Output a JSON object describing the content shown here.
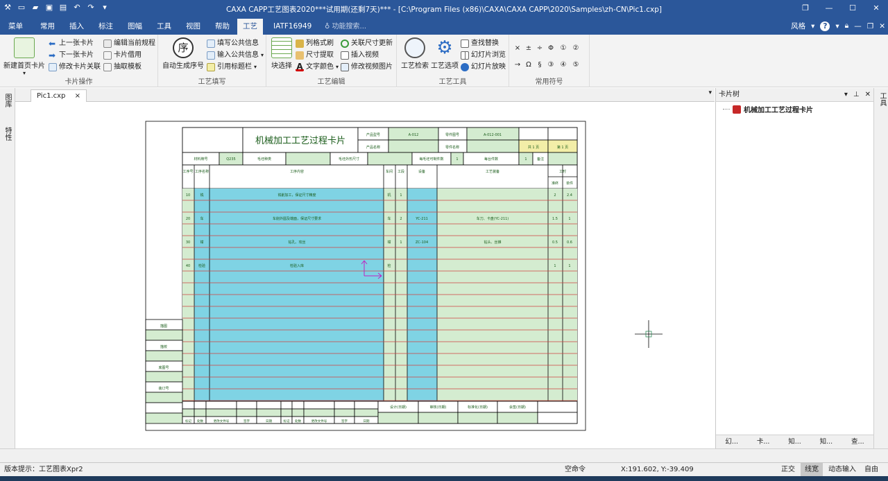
{
  "window": {
    "title": "CAXA CAPP工艺图表2020***试用期(还剩7天)*** - [C:\\Program Files (x86)\\CAXA\\CAXA CAPP\\2020\\Samples\\zh-CN\\Pic1.cxp]",
    "controls": [
      "restore-icon",
      "minimize-icon",
      "maximize-icon",
      "close-icon"
    ]
  },
  "menu": {
    "tabs": [
      "菜单",
      "常用",
      "插入",
      "标注",
      "图幅",
      "工具",
      "视图",
      "帮助",
      "工艺",
      "IATF16949"
    ],
    "active_tab": "工艺",
    "search_placeholder": "功能搜索...",
    "style_label": "风格",
    "help": "?"
  },
  "ribbon": {
    "groups": [
      {
        "label": "卡片操作",
        "big": [
          {
            "label": "新建首页卡片",
            "icon": "new-card-icon"
          }
        ],
        "small": [
          {
            "label": "上一张卡片",
            "icon": "arrow-left-icon"
          },
          {
            "label": "下一张卡片",
            "icon": "arrow-right-icon"
          },
          {
            "label": "修改卡片关联",
            "icon": "link-card-icon"
          },
          {
            "label": "编辑当前规程",
            "icon": "edit-procedure-icon"
          },
          {
            "label": "卡片借用",
            "icon": "borrow-card-icon"
          },
          {
            "label": "抽取模板",
            "icon": "extract-template-icon"
          }
        ]
      },
      {
        "label": "工艺填写",
        "big": [
          {
            "label": "自动生成序号",
            "icon": "sequence-icon",
            "glyph": "序"
          }
        ],
        "small": [
          {
            "label": "填写公共信息",
            "icon": "fill-info-icon"
          },
          {
            "label": "输入公共信息",
            "icon": "input-info-icon"
          },
          {
            "label": "引用标题栏",
            "icon": "title-bar-icon"
          }
        ]
      },
      {
        "label": "工艺编辑",
        "big": [
          {
            "label": "块选择",
            "icon": "block-select-icon"
          }
        ],
        "small": [
          {
            "label": "列格式刷",
            "icon": "format-brush-icon"
          },
          {
            "label": "尺寸提取",
            "icon": "dimension-extract-icon"
          },
          {
            "label": "文字颜色",
            "icon": "text-color-icon",
            "glyph": "A"
          },
          {
            "label": "关联尺寸更新",
            "icon": "refresh-dimension-icon"
          },
          {
            "label": "插入视频",
            "icon": "insert-video-icon"
          },
          {
            "label": "修改视频图片",
            "icon": "edit-video-image-icon"
          }
        ]
      },
      {
        "label": "工艺工具",
        "big": [
          {
            "label": "工艺检索",
            "icon": "search-process-icon"
          },
          {
            "label": "工艺选项",
            "icon": "gear-icon"
          }
        ],
        "small": [
          {
            "label": "查找替换",
            "icon": "find-replace-icon"
          },
          {
            "label": "幻灯片浏览",
            "icon": "slide-browse-icon"
          },
          {
            "label": "幻灯片放映",
            "icon": "slide-play-icon"
          }
        ]
      },
      {
        "label": "常用符号",
        "symbols": [
          "×",
          "±",
          "÷",
          "Φ",
          "①",
          "②",
          "→",
          "Ω",
          "§",
          "③",
          "④",
          "⑤"
        ]
      }
    ]
  },
  "left_tabs": [
    "图库",
    "特性"
  ],
  "document_tab": {
    "label": "Pic1.cxp",
    "close": "×"
  },
  "right_panel": {
    "title": "卡片树",
    "tree_root": "机械加工工艺过程卡片",
    "bottom_tabs": [
      "幻...",
      "卡...",
      "知...",
      "知...",
      "查..."
    ]
  },
  "right_strip": [
    "工具"
  ],
  "card": {
    "title": "机械加工工艺过程卡片",
    "header_labels": [
      "产品型号",
      "产品名称",
      "零件图号",
      "零件名称",
      "共 1 页",
      "第 1 页"
    ],
    "header_values": [
      "A-012",
      "",
      "A-012-001",
      "",
      "",
      ""
    ],
    "second_row": [
      "材料牌号",
      "Q235",
      "毛坯种类",
      "",
      "毛坯外形尺寸",
      "",
      "每毛坯可制件数",
      "1",
      "每台件数",
      "1",
      "备注",
      ""
    ],
    "columns": [
      "工序号",
      "工序名称",
      "工序内容",
      "车间",
      "工段",
      "设备",
      "工艺装备",
      "工时",
      "准终",
      "单件"
    ],
    "rows": [
      {
        "no": "10",
        "name": "铣",
        "content": "铣削加工，保证尺寸精度",
        "ws": "机",
        "sec": "1",
        "eq": "",
        "tool": "",
        "t1": "2",
        "t2": "2.4"
      },
      {
        "no": "20",
        "name": "车",
        "content": "车削外圆及端面，保证尺寸要求",
        "ws": "车",
        "sec": "2",
        "eq": "YC-211",
        "tool": "车刀、卡盘(YC-211)",
        "t1": "1.5",
        "t2": "1"
      },
      {
        "no": "30",
        "name": "钳",
        "content": "钻孔、攻丝",
        "ws": "钳",
        "sec": "1",
        "eq": "ZC-104",
        "tool": "钻头、丝锥",
        "t1": "0.5",
        "t2": "0.6"
      },
      {
        "no": "40",
        "name": "检验",
        "content": "检验入库",
        "ws": "检",
        "sec": "",
        "eq": "",
        "tool": "",
        "t1": "1",
        "t2": "1"
      }
    ],
    "side_labels": [
      "描图",
      "描校",
      "底图号",
      "装订号"
    ],
    "sign_labels": [
      "设计(日期)",
      "审核(日期)",
      "标准化(日期)",
      "会签(日期)"
    ],
    "change_labels": [
      "标记",
      "处数",
      "更改文件号",
      "签字",
      "日期",
      "标记",
      "处数",
      "更改文件号",
      "签字",
      "日期"
    ]
  },
  "status": {
    "hint": "版本提示：工艺图表Xpr2",
    "command": "空命令",
    "coords": "X:191.602, Y:-39.409",
    "ortho": "正交",
    "linewidth": "线宽",
    "dynamic": "动态输入",
    "auto": "自由"
  },
  "colors": {
    "title_bar": "#2b579a",
    "card_green": "#d4ecd0",
    "card_cyan": "#7fd3e4",
    "card_yellow": "#f3eea8",
    "row_line_red": "#d04040"
  }
}
